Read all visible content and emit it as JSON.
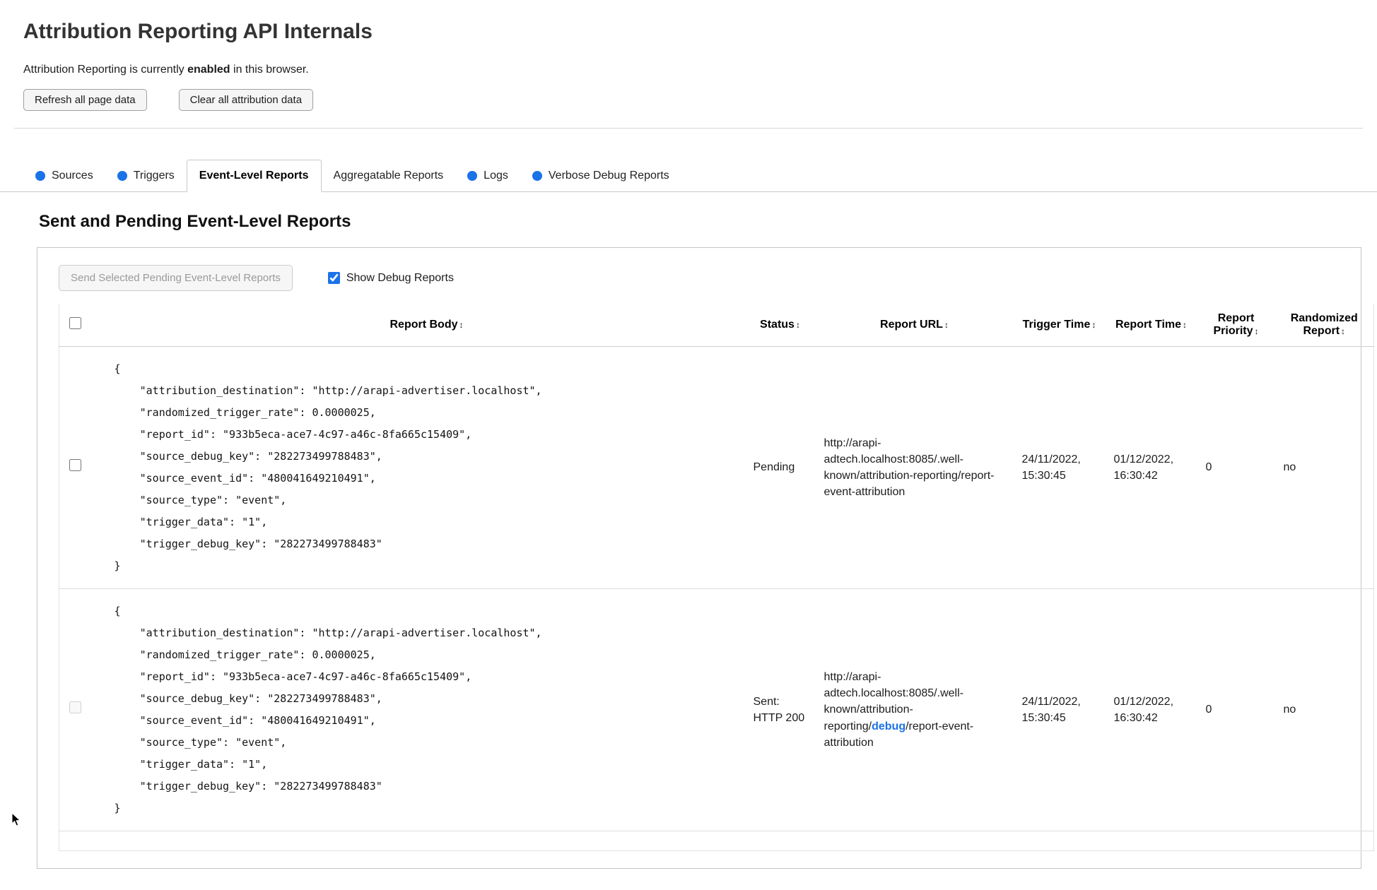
{
  "header": {
    "title": "Attribution Reporting API Internals",
    "status_prefix": "Attribution Reporting is currently ",
    "status_bold": "enabled",
    "status_suffix": " in this browser.",
    "refresh_button": "Refresh all page data",
    "clear_button": "Clear all attribution data"
  },
  "tabs": [
    {
      "label": "Sources",
      "dot": true
    },
    {
      "label": "Triggers",
      "dot": true
    },
    {
      "label": "Event-Level Reports",
      "dot": false,
      "active": true
    },
    {
      "label": "Aggregatable Reports",
      "dot": false
    },
    {
      "label": "Logs",
      "dot": true
    },
    {
      "label": "Verbose Debug Reports",
      "dot": true
    }
  ],
  "section": {
    "heading": "Sent and Pending Event-Level Reports",
    "send_button_label": "Send Selected Pending Event-Level Reports",
    "send_button_disabled": "disabled",
    "show_debug_label": "Show Debug Reports",
    "show_debug_checked": "checked"
  },
  "icons": {
    "sort": "↕",
    "new_data_dot": "●"
  },
  "colors": {
    "accent_blue": "#1a73e8"
  },
  "table": {
    "columns": [
      "Report Body",
      "Status",
      "Report URL",
      "Trigger Time",
      "Report Time",
      "Report Priority",
      "Randomized Report"
    ],
    "rows": [
      {
        "body": "{\n    \"attribution_destination\": \"http://arapi-advertiser.localhost\",\n    \"randomized_trigger_rate\": 0.0000025,\n    \"report_id\": \"933b5eca-ace7-4c97-a46c-8fa665c15409\",\n    \"source_debug_key\": \"282273499788483\",\n    \"source_event_id\": \"480041649210491\",\n    \"source_type\": \"event\",\n    \"trigger_data\": \"1\",\n    \"trigger_debug_key\": \"282273499788483\"\n}",
        "status": "Pending",
        "url": "http://arapi-adtech.localhost:8085/.well-known/attribution-reporting/report-event-attribution",
        "trigger_time": "24/11/2022, 15:30:45",
        "report_time": "01/12/2022, 16:30:42",
        "report_priority": "0",
        "randomized_report": "no"
      },
      {
        "body": "{\n    \"attribution_destination\": \"http://arapi-advertiser.localhost\",\n    \"randomized_trigger_rate\": 0.0000025,\n    \"report_id\": \"933b5eca-ace7-4c97-a46c-8fa665c15409\",\n    \"source_debug_key\": \"282273499788483\",\n    \"source_event_id\": \"480041649210491\",\n    \"source_type\": \"event\",\n    \"trigger_data\": \"1\",\n    \"trigger_debug_key\": \"282273499788483\"\n}",
        "status": "Sent: HTTP 200",
        "url_prefix": "http://arapi-adtech.localhost:8085/.well-known/attribution-reporting/",
        "url_debug": "debug",
        "url_suffix": "/report-event-attribution",
        "trigger_time": "24/11/2022, 15:30:45",
        "report_time": "01/12/2022, 16:30:42",
        "report_priority": "0",
        "randomized_report": "no",
        "checkbox_disabled": "disabled"
      }
    ]
  }
}
